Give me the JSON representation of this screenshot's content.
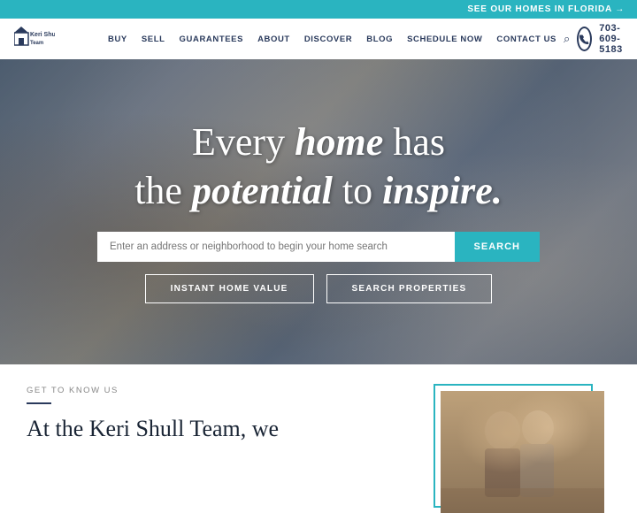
{
  "banner": {
    "text": "SEE OUR HOMES IN FLORIDA →"
  },
  "nav": {
    "logo_line1": "Keri Shull Team",
    "links": [
      "BUY",
      "SELL",
      "GUARANTEES",
      "ABOUT",
      "DISCOVER",
      "BLOG",
      "SCHEDULE NOW",
      "CONTACT US"
    ],
    "phone": "703-609-5183"
  },
  "hero": {
    "line1_plain": "Every ",
    "line1_italic": "home",
    "line1_end": " has",
    "line2_start": "the ",
    "line2_italic1": "potential",
    "line2_mid": " to ",
    "line2_italic2": "inspire.",
    "search_placeholder": "Enter an address or neighborhood to begin your home search",
    "search_btn": "SEARCH",
    "cta1": "INSTANT HOME VALUE",
    "cta2": "SEARCH PROPERTIES"
  },
  "below": {
    "section_label": "GET TO KNOW US",
    "heading_line1": "At the Keri Shull Team, we"
  }
}
